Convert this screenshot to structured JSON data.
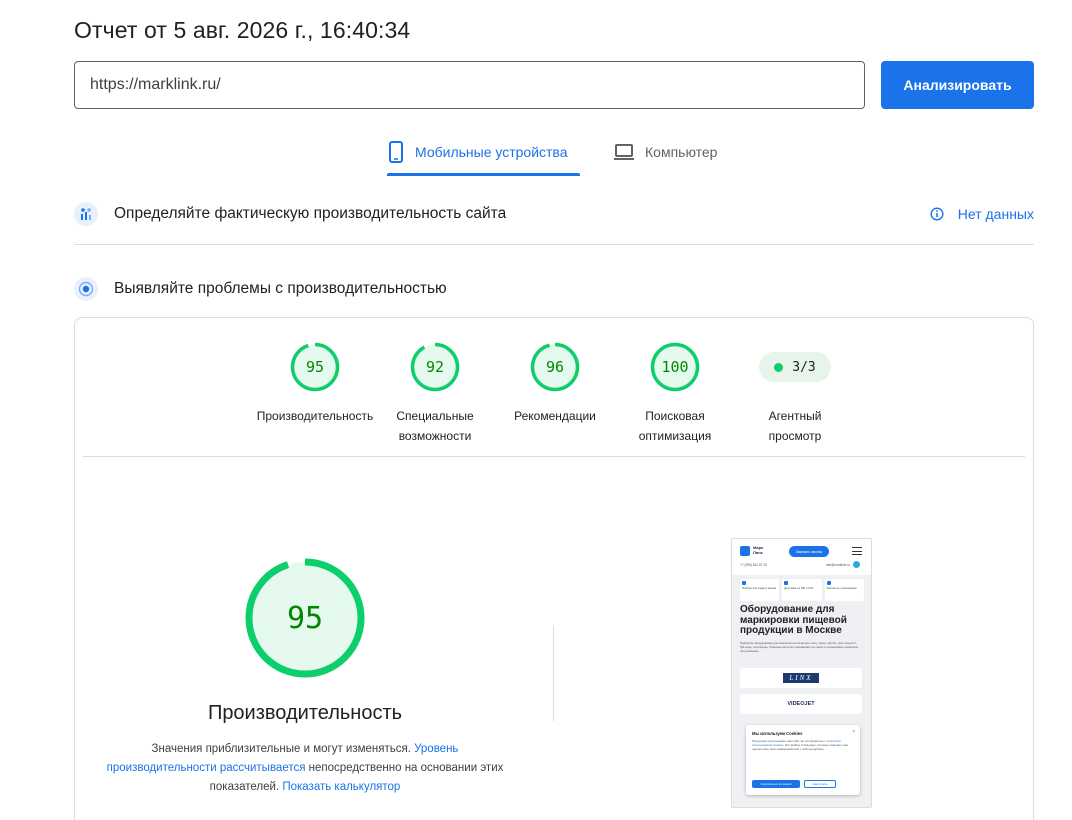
{
  "header": {
    "report_title": "Отчет от 5 авг. 2026 г., 16:40:34",
    "url_value": "https://marklink.ru/",
    "analyze_label": "Анализировать"
  },
  "tabs": [
    {
      "label": "Мобильные устройства",
      "icon": "phone-icon",
      "active": true
    },
    {
      "label": "Компьютер",
      "icon": "laptop-icon",
      "active": false
    }
  ],
  "field_data": {
    "title": "Определяйте фактическую производительность сайта",
    "status": "Нет данных",
    "status_icon": "info-icon"
  },
  "lab_data": {
    "title": "Выявляйте проблемы с производительностью"
  },
  "scores": [
    {
      "name": "performance",
      "label_line1": "Производительность",
      "label_line2": "",
      "value": 95
    },
    {
      "name": "accessibility",
      "label_line1": "Специальные",
      "label_line2": "возможности",
      "value": 92
    },
    {
      "name": "best-practices",
      "label_line1": "Рекомендации",
      "label_line2": "",
      "value": 96
    },
    {
      "name": "seo",
      "label_line1": "Поисковая",
      "label_line2": "оптимизация",
      "value": 100
    }
  ],
  "agent": {
    "value": "3/3",
    "label_line1": "Агентный",
    "label_line2": "просмотр"
  },
  "performance_detail": {
    "score": 95,
    "title": "Производительность",
    "desc_part1": "Значения приблизительные и могут изменяться.",
    "desc_link1": "Уровень производительности рассчитывается",
    "desc_part2": "непосредственно на основании этих показателей.",
    "desc_link2": "Показать калькулятор"
  },
  "screenshot": {
    "logo_line1": "Марк",
    "logo_line2": "Линк",
    "cta": "Заказать звонок",
    "phone": "+7 (925) 811-07-10",
    "email": "info@marklink.ru",
    "feature1": "Подбор под задачу заказа",
    "feature2": "Доставка по РФ и СНГ",
    "feature3": "Запчасти и расходники",
    "hero_title": "Оборудование для маркировки пищевой продукции в Москве",
    "hero_text": "Подберём оборудование для нанесения на печатную ленту: даты, партии, срок годности, QR-коды, штрихкоды. Поможем запустить маркировку на линии и организовать сервисное обслуживание.",
    "brand1": "LINX",
    "brand2": "VIDEOJET",
    "cookie_title": "Мы используем Cookies",
    "cookie_text": "Продолжая использовать наш сайт, вы соглашаетесь с",
    "cookie_link": "политикой использования Cookies.",
    "cookie_text2": "Это файлы в браузере, которые помогают нам сделать ваш опыт взаимодействия с сайтом удобнее.",
    "cookie_accept": "Согласиться со всеми",
    "cookie_settings": "Настроить"
  },
  "colors": {
    "accent": "#1a73e8",
    "pass": "#0cce6b",
    "pass_text": "#008800",
    "pass_bg": "#e6f4ea"
  }
}
